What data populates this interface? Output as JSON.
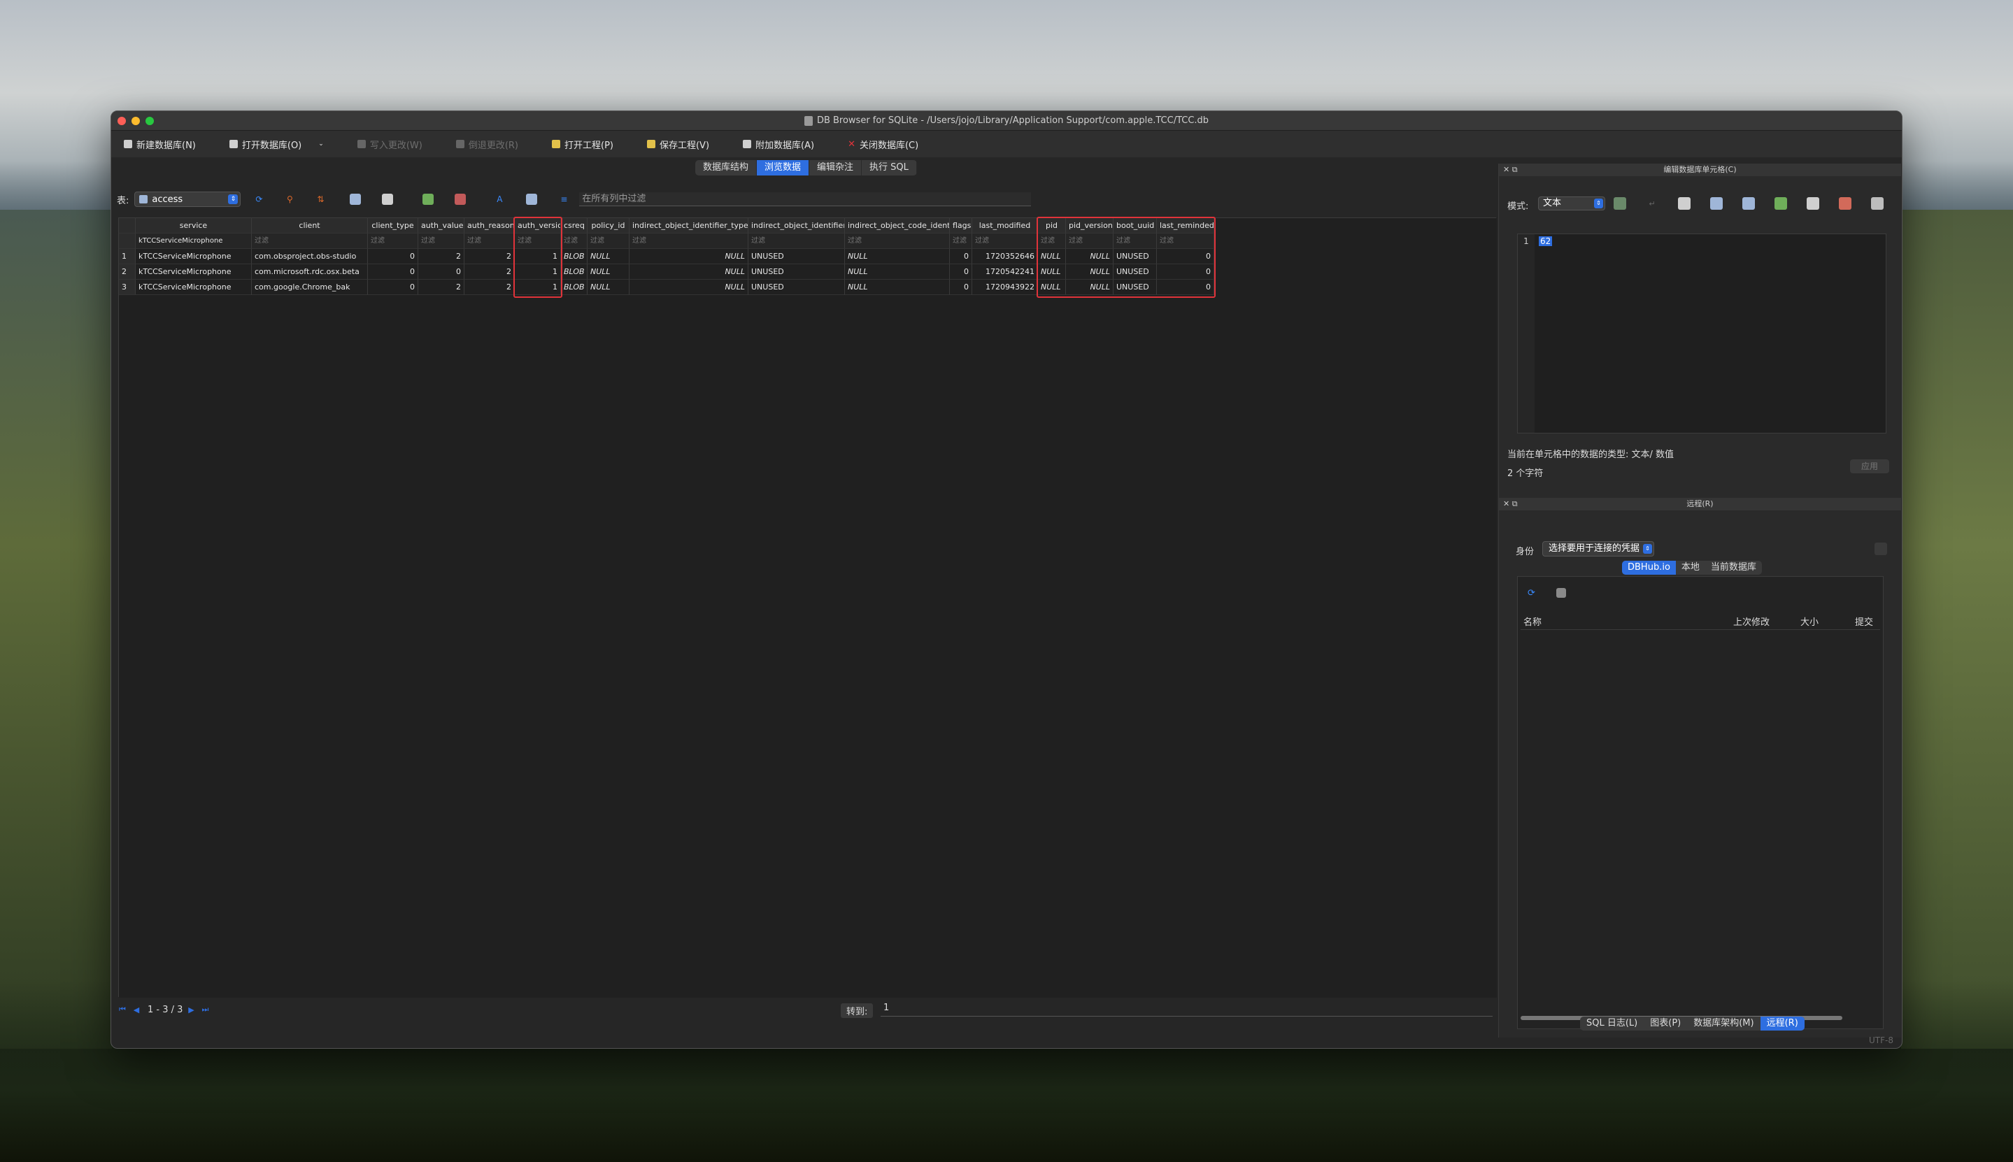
{
  "window": {
    "title": "DB Browser for SQLite - /Users/jojo/Library/Application Support/com.apple.TCC/TCC.db"
  },
  "toolbar": {
    "new_db": "新建数据库(N)",
    "open_db": "打开数据库(O)",
    "write_changes": "写入更改(W)",
    "revert_changes": "倒退更改(R)",
    "open_project": "打开工程(P)",
    "save_project": "保存工程(V)",
    "attach_db": "附加数据库(A)",
    "close_db": "关闭数据库(C)"
  },
  "main_tabs": [
    "数据库结构",
    "浏览数据",
    "编辑杂注",
    "执行 SQL"
  ],
  "browse": {
    "table_label": "表:",
    "table_value": "access",
    "global_filter_placeholder": "在所有列中过滤",
    "filter_placeholder": "过滤",
    "columns": [
      "service",
      "client",
      "client_type",
      "auth_value",
      "auth_reason",
      "auth_version",
      "csreq",
      "policy_id",
      "indirect_object_identifier_type",
      "indirect_object_identifier",
      "indirect_object_code_identity",
      "flags",
      "last_modified",
      "pid",
      "pid_version",
      "boot_uuid",
      "last_reminded"
    ],
    "sort_indicator": "-¹",
    "service_filter_value": "kTCCServiceMicrophone",
    "rows": [
      {
        "num": "1",
        "values": [
          "kTCCServiceMicrophone",
          "com.obsproject.obs-studio",
          "0",
          "2",
          "2",
          "1",
          "BLOB",
          "NULL",
          "NULL",
          "UNUSED",
          "NULL",
          "0",
          "1720352646",
          "NULL",
          "NULL",
          "UNUSED",
          "0"
        ]
      },
      {
        "num": "2",
        "values": [
          "kTCCServiceMicrophone",
          "com.microsoft.rdc.osx.beta",
          "0",
          "0",
          "2",
          "1",
          "BLOB",
          "NULL",
          "NULL",
          "UNUSED",
          "NULL",
          "0",
          "1720542241",
          "NULL",
          "NULL",
          "UNUSED",
          "0"
        ]
      },
      {
        "num": "3",
        "values": [
          "kTCCServiceMicrophone",
          "com.google.Chrome_bak",
          "0",
          "2",
          "2",
          "1",
          "BLOB",
          "NULL",
          "NULL",
          "UNUSED",
          "NULL",
          "0",
          "1720943922",
          "NULL",
          "NULL",
          "UNUSED",
          "0"
        ]
      }
    ],
    "pager": "1 - 3 / 3",
    "goto_label": "转到:",
    "goto_value": "1"
  },
  "edit_cell": {
    "title": "编辑数据库单元格(C)",
    "mode_label": "模式:",
    "mode_value": "文本",
    "line_number": "1",
    "content": "62",
    "type_info": "当前在单元格中的数据的类型: 文本/ 数值",
    "char_count": "2 个字符",
    "apply": "应用"
  },
  "remote": {
    "title": "远程(R)",
    "identity_label": "身份",
    "identity_placeholder": "选择要用于连接的凭据",
    "tabs": [
      "DBHub.io",
      "本地",
      "当前数据库"
    ],
    "columns": [
      "名称",
      "上次修改",
      "大小",
      "提交"
    ]
  },
  "bottom_tabs": [
    "SQL 日志(L)",
    "图表(P)",
    "数据库架构(M)",
    "远程(R)"
  ],
  "status": {
    "encoding": "UTF-8"
  },
  "colors": {
    "accent": "#2e6ee0",
    "highlight": "#e0333a",
    "window_bg": "#262626"
  }
}
